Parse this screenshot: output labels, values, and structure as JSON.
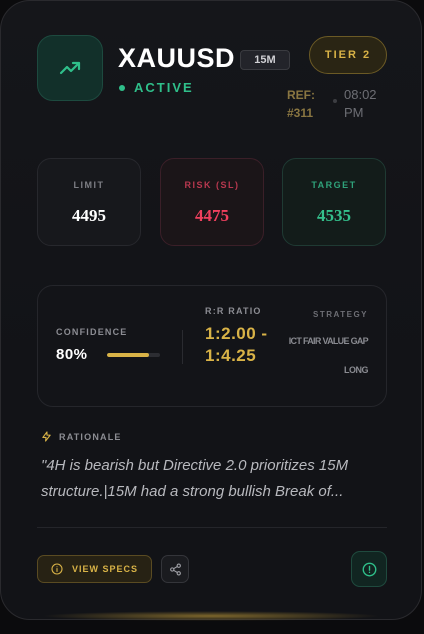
{
  "header": {
    "symbol": "XAUUSD",
    "timeframe": "15M",
    "status": "ACTIVE",
    "tier": "TIER 2",
    "ref": "REF: #311",
    "time": "08:02 PM",
    "icon": "trending-up-icon"
  },
  "metrics": {
    "limit": {
      "label": "LIMIT",
      "value": "4495"
    },
    "risk": {
      "label": "RISK (SL)",
      "value": "4475"
    },
    "target": {
      "label": "TARGET",
      "value": "4535"
    }
  },
  "panel": {
    "confidence_label": "CONFIDENCE",
    "confidence_value": "80%",
    "confidence_fraction": 0.8,
    "rr_label": "R:R RATIO",
    "rr_value": "1:2.00 - 1:4.25",
    "strategy_label": "STRATEGY",
    "strategy_value": "ICT FAIR VALUE GAP",
    "direction": "LONG"
  },
  "rationale": {
    "label": "RATIONALE",
    "text": "\"4H is bearish but Directive 2.0 prioritizes 15M structure.|15M had a strong bullish Break of..."
  },
  "actions": {
    "view_specs_label": "VIEW SPECS"
  },
  "colors": {
    "gold": "#d9b347",
    "green": "#2fbf8a",
    "red": "#f0405e"
  }
}
